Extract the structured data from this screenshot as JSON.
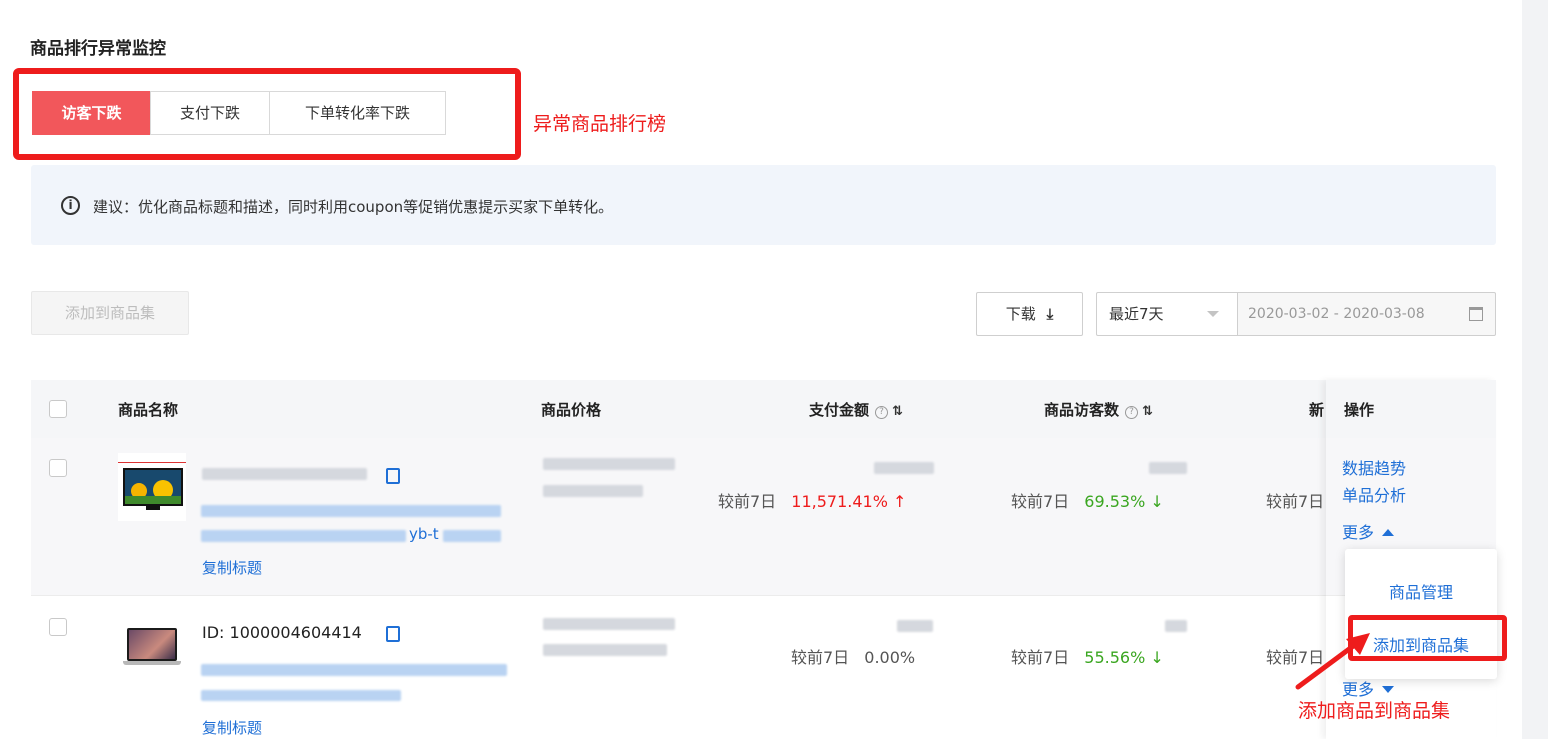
{
  "section_title": "商品排行异常监控",
  "tabs": [
    {
      "label": "访客下跌",
      "active": true
    },
    {
      "label": "支付下跌",
      "active": false
    },
    {
      "label": "下单转化率下跌",
      "active": false
    }
  ],
  "annotations": {
    "ranking": "异常商品排行榜",
    "add_to_set": "添加商品到商品集"
  },
  "tip": {
    "icon": "info-icon",
    "text": "建议：优化商品标题和描述，同时利用coupon等促销优惠提示买家下单转化。"
  },
  "toolbar": {
    "add_to_set": "添加到商品集",
    "download": "下载",
    "range": "最近7天",
    "date_range": "2020-03-02 - 2020-03-08"
  },
  "table": {
    "headers": {
      "name": "商品名称",
      "price": "商品价格",
      "pay_amount": "支付金额",
      "visitors": "商品访客数",
      "next": "新",
      "ops": "操作"
    },
    "rows": [
      {
        "id_text": "",
        "title_fragment": "yb-t",
        "copy_title": "复制标题",
        "pay_cmp_label": "较前7日",
        "pay_cmp_value": "11,571.41%",
        "pay_trend": "up",
        "visit_cmp_label": "较前7日",
        "visit_cmp_value": "69.53%",
        "visit_trend": "down",
        "next_cmp_label": "较前7日"
      },
      {
        "id_text": "ID: 1000004604414",
        "copy_title": "复制标题",
        "pay_cmp_label": "较前7日",
        "pay_cmp_value": "0.00%",
        "pay_trend": "none",
        "visit_cmp_label": "较前7日",
        "visit_cmp_value": "55.56%",
        "visit_trend": "down",
        "next_cmp_label": "较前7日"
      }
    ]
  },
  "ops": {
    "data_trend": "数据趋势",
    "single_analysis": "单品分析",
    "more": "更多",
    "dropdown": {
      "manage": "商品管理",
      "add_to_set": "添加到商品集"
    }
  },
  "colors": {
    "accent_red": "#f2575b",
    "link_blue": "#1f6fd6",
    "trend_up": "#ee1c1c",
    "trend_down": "#3aa620",
    "annotation_red": "#ee1c1c"
  }
}
